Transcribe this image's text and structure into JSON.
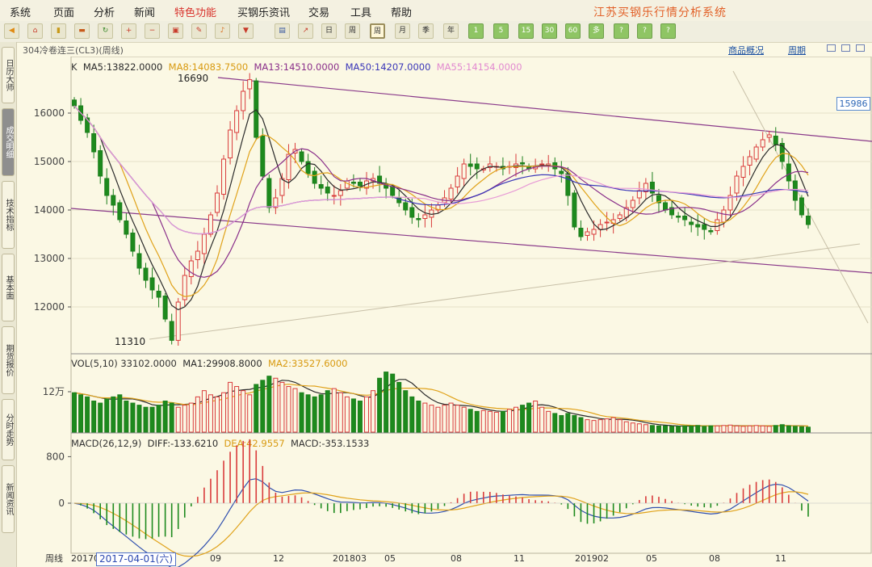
{
  "menu": {
    "items": [
      "系统",
      "页面",
      "分析",
      "新闻",
      "特色功能",
      "买钢乐资讯",
      "交易",
      "工具",
      "帮助"
    ],
    "active_index": 4,
    "brand": "江苏买钢乐行情分析系统"
  },
  "toolbar": {
    "period_buttons": [
      "日",
      "周",
      "月",
      "季",
      "年",
      "1",
      "5",
      "15",
      "30",
      "60",
      "多",
      "?"
    ],
    "active_period": "周"
  },
  "titlebar": {
    "symbol": "304冷卷连三(CL3)(周线)",
    "link_1": "商品概况",
    "link_2": "周期"
  },
  "sidebar": {
    "tabs": [
      "日历大师",
      "成交明细",
      "技术指标",
      "基本面",
      "期货报价",
      "分时走势",
      "新闻资讯"
    ],
    "active_index": 1
  },
  "indicators": {
    "kline": [
      {
        "text": "K",
        "color": "#333333"
      },
      {
        "text": "MA5:13822.0000",
        "color": "#2a2a2a"
      },
      {
        "text": "MA8:14083.7500",
        "color": "#d89a10"
      },
      {
        "text": "MA13:14510.0000",
        "color": "#8a2f8a"
      },
      {
        "text": "MA50:14207.0000",
        "color": "#3a36b8"
      },
      {
        "text": "MA55:14154.0000",
        "color": "#e28ad0"
      }
    ],
    "vol": [
      {
        "text": "VOL(5,10) 33102.0000",
        "color": "#333333"
      },
      {
        "text": "MA1:29908.8000",
        "color": "#2a2a2a"
      },
      {
        "text": "MA2:33527.6000",
        "color": "#d89a10"
      }
    ],
    "macd": [
      {
        "text": "MACD(26,12,9)",
        "color": "#333333"
      },
      {
        "text": "DIFF:-133.6210",
        "color": "#2a2a2a"
      },
      {
        "text": "DEA:42.9557",
        "color": "#d89a10"
      },
      {
        "text": "MACD:-353.1533",
        "color": "#333333"
      }
    ]
  },
  "axis": {
    "price_ticks": [
      "16000",
      "15000",
      "14000",
      "13000",
      "12000"
    ],
    "vol_tick": "12万",
    "macd_ticks": [
      "800",
      "0"
    ],
    "x_label": "周线",
    "x_ticks": [
      "20170",
      "09",
      "12",
      "201803",
      "05",
      "08",
      "11",
      "201902",
      "05",
      "08",
      "11"
    ],
    "current_price": "15986",
    "hover_date": "2017-04-01(六)"
  },
  "chart_data": {
    "type": "candlestick",
    "period": "weekly",
    "ylim": [
      11000,
      17000
    ],
    "annotations": [
      {
        "label": "16690",
        "value": 16690
      },
      {
        "label": "11310",
        "value": 11310
      }
    ],
    "closes": [
      16150,
      15850,
      15600,
      15200,
      14700,
      14300,
      14100,
      13800,
      13500,
      13150,
      12800,
      12550,
      12350,
      12200,
      11750,
      11310,
      12100,
      12650,
      12950,
      13150,
      13500,
      13900,
      14350,
      15050,
      15650,
      16050,
      16450,
      16690,
      15500,
      14700,
      14050,
      14250,
      14650,
      15150,
      15250,
      15000,
      14750,
      14550,
      14450,
      14350,
      14300,
      14400,
      14600,
      14550,
      14500,
      14600,
      14650,
      14550,
      14450,
      14300,
      14150,
      14000,
      13850,
      13800,
      13900,
      14000,
      14100,
      14250,
      14450,
      14700,
      14950,
      14900,
      14850,
      14850,
      14950,
      14900,
      14850,
      14900,
      14950,
      14950,
      14850,
      14900,
      14950,
      14950,
      14850,
      14750,
      14300,
      13650,
      13450,
      13550,
      13600,
      13700,
      13750,
      13800,
      13900,
      14050,
      14200,
      14400,
      14550,
      14350,
      14150,
      14000,
      13900,
      13850,
      13800,
      13700,
      13650,
      13600,
      13550,
      13800,
      14000,
      14300,
      14700,
      14900,
      15100,
      15300,
      15450,
      15550,
      15350,
      15000,
      14600,
      14200,
      13900,
      13700
    ],
    "volumes": [
      0.095,
      0.09,
      0.085,
      0.075,
      0.07,
      0.08,
      0.085,
      0.09,
      0.075,
      0.07,
      0.065,
      0.06,
      0.06,
      0.065,
      0.075,
      0.07,
      0.06,
      0.065,
      0.07,
      0.085,
      0.1,
      0.09,
      0.085,
      0.095,
      0.12,
      0.11,
      0.1,
      0.09,
      0.115,
      0.125,
      0.135,
      0.13,
      0.12,
      0.11,
      0.105,
      0.095,
      0.09,
      0.085,
      0.09,
      0.1,
      0.105,
      0.095,
      0.085,
      0.08,
      0.075,
      0.085,
      0.1,
      0.13,
      0.145,
      0.14,
      0.12,
      0.1,
      0.085,
      0.075,
      0.07,
      0.065,
      0.06,
      0.065,
      0.07,
      0.065,
      0.06,
      0.055,
      0.05,
      0.052,
      0.05,
      0.048,
      0.05,
      0.055,
      0.06,
      0.065,
      0.07,
      0.075,
      0.06,
      0.05,
      0.045,
      0.04,
      0.045,
      0.04,
      0.035,
      0.03,
      0.028,
      0.03,
      0.032,
      0.035,
      0.03,
      0.025,
      0.022,
      0.02,
      0.018,
      0.016,
      0.015,
      0.015,
      0.014,
      0.014,
      0.015,
      0.015,
      0.016,
      0.014,
      0.015,
      0.015,
      0.016,
      0.017,
      0.015,
      0.014,
      0.015,
      0.016,
      0.015,
      0.014,
      0.016,
      0.018,
      0.015,
      0.014,
      0.013,
      0.012
    ]
  }
}
